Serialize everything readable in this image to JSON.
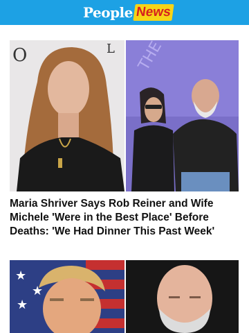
{
  "header": {
    "brand_people": "People",
    "brand_news": "News",
    "bg_color": "#1da1e4",
    "news_badge_color": "#f7d417"
  },
  "article": {
    "headline": "Maria Shriver Says Rob Reiner and Wife Michele 'Were in the Best Place' Before Deaths: 'We Had Dinner This Past Week'"
  },
  "images": {
    "main_left": "woman-portrait-photo",
    "main_right": "couple-event-photo",
    "thumb_left": "man-flag-background-photo",
    "thumb_right": "bald-man-portrait-photo"
  }
}
